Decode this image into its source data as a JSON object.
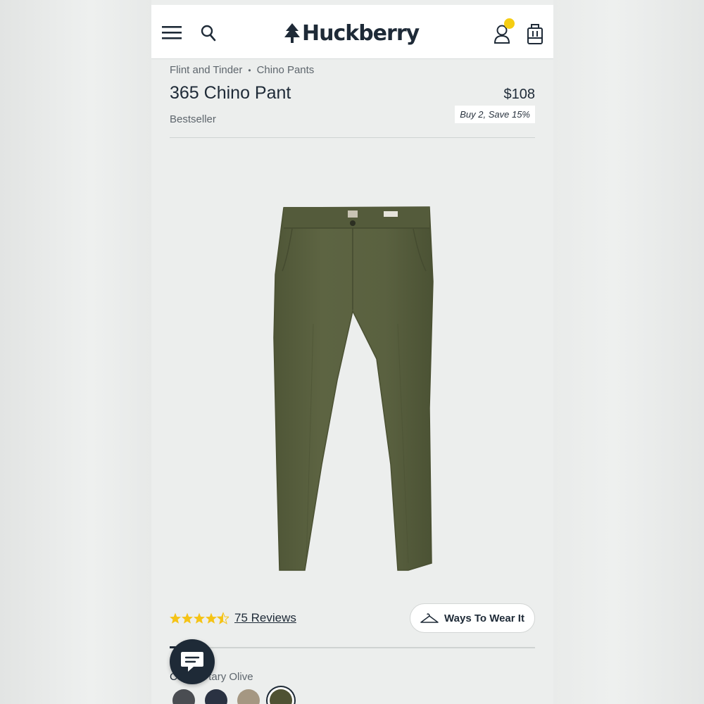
{
  "header": {
    "logo_text": "Huckberry"
  },
  "breadcrumb": {
    "brand": "Flint and Tinder",
    "separator": "•",
    "category": "Chino Pants"
  },
  "product": {
    "title": "365 Chino Pant",
    "price": "$108",
    "promo": "Buy 2, Save 15%",
    "tag": "Bestseller",
    "rating_value": 4.5,
    "reviews_label": "75 Reviews"
  },
  "actions": {
    "ways_to_wear_label": "Ways To Wear It"
  },
  "color": {
    "label_prefix": "Co",
    "selected_name": "tary Olive",
    "swatches": [
      {
        "name": "charcoal",
        "hex": "#4a4d52"
      },
      {
        "name": "navy",
        "hex": "#2a3242"
      },
      {
        "name": "khaki",
        "hex": "#a59782"
      },
      {
        "name": "olive",
        "hex": "#4f5233"
      }
    ]
  },
  "colors": {
    "brand_dark": "#1e2a37",
    "notify_yellow": "#f5cd12",
    "star_yellow": "#f5c316",
    "pant_olive": "#59603f"
  }
}
